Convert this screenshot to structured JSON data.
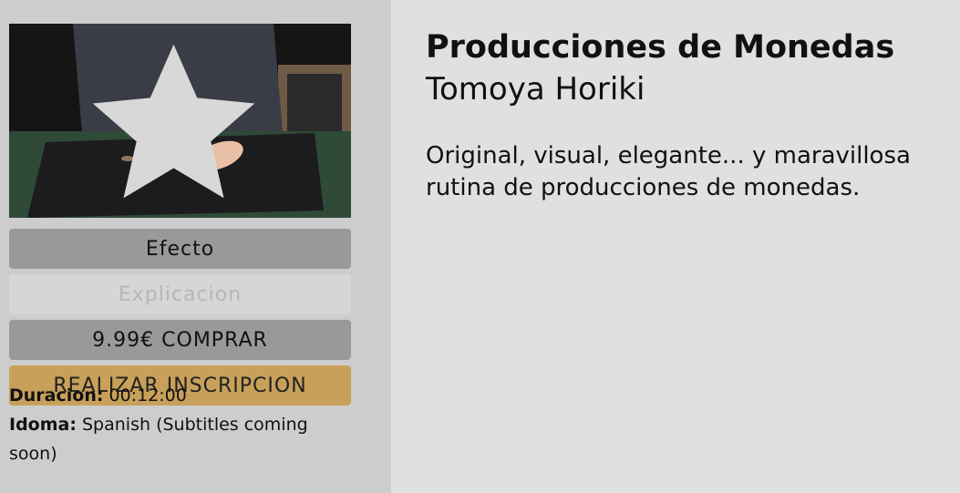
{
  "product": {
    "title": "Producciones de Monedas",
    "author": "Tomoya Horiki",
    "description": "Original, visual, elegante... y maravillosa rutina de producciones de monedas."
  },
  "thumbnail": {
    "favorite_icon": "star-icon"
  },
  "buttons": {
    "efecto": "Efecto",
    "explicacion": "Explicacion",
    "buy": "9.99€ COMPRAR",
    "register": "REALIZAR INSCRIPCION"
  },
  "details": {
    "duration_label": "Duracion:",
    "duration_value": "00:12:00",
    "language_label": "Idoma:",
    "language_value": "Spanish (Subtitles coming soon)"
  },
  "colors": {
    "sidebar_bg": "#cdcdcd",
    "page_bg": "#e0e0e0",
    "button_gray": "#999999",
    "button_disabled": "#d6d6d6",
    "button_gold": "#c9a05a"
  }
}
